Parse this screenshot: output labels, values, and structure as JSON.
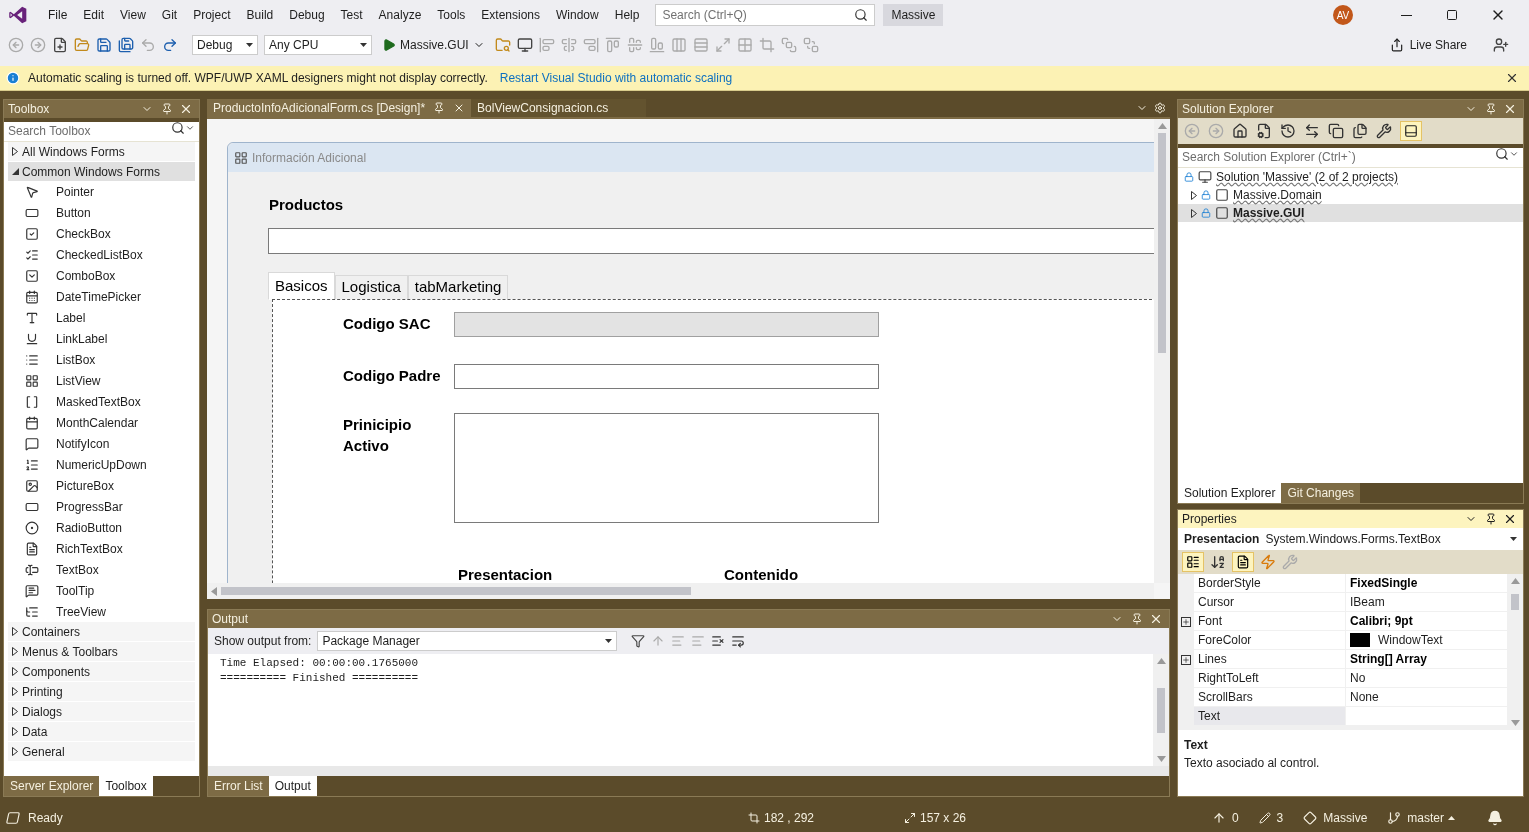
{
  "menu_bar": {
    "items": [
      "File",
      "Edit",
      "View",
      "Git",
      "Project",
      "Build",
      "Debug",
      "Test",
      "Analyze",
      "Tools",
      "Extensions",
      "Window",
      "Help"
    ],
    "search": {
      "placeholder": "Search (Ctrl+Q)"
    },
    "solution_name": "Massive",
    "avatar": "AV"
  },
  "toolbar": {
    "configuration": "Debug",
    "platform": "Any CPU",
    "start_project": "Massive.GUI",
    "live_share": "Live Share"
  },
  "info_bar": {
    "message": "Automatic scaling is turned off. WPF/UWP XAML designers might not display correctly.",
    "link": "Restart Visual Studio with automatic scaling"
  },
  "toolbox": {
    "title": "Toolbox",
    "search": {
      "placeholder": "Search Toolbox"
    },
    "groups": [
      {
        "label": "All Windows Forms",
        "expanded": false,
        "selected": false
      },
      {
        "label": "Common Windows Forms",
        "expanded": true,
        "selected": true,
        "items": [
          "Pointer",
          "Button",
          "CheckBox",
          "CheckedListBox",
          "ComboBox",
          "DateTimePicker",
          "Label",
          "LinkLabel",
          "ListBox",
          "ListView",
          "MaskedTextBox",
          "MonthCalendar",
          "NotifyIcon",
          "NumericUpDown",
          "PictureBox",
          "ProgressBar",
          "RadioButton",
          "RichTextBox",
          "TextBox",
          "ToolTip",
          "TreeView"
        ]
      },
      {
        "label": "Containers",
        "expanded": false,
        "selected": false
      },
      {
        "label": "Menus & Toolbars",
        "expanded": false,
        "selected": false
      },
      {
        "label": "Components",
        "expanded": false,
        "selected": false
      },
      {
        "label": "Printing",
        "expanded": false,
        "selected": false
      },
      {
        "label": "Dialogs",
        "expanded": false,
        "selected": false
      },
      {
        "label": "Data",
        "expanded": false,
        "selected": false
      },
      {
        "label": "General",
        "expanded": false,
        "selected": false
      }
    ],
    "tabs": [
      {
        "label": "Server Explorer",
        "selected": false
      },
      {
        "label": "Toolbox",
        "selected": true
      }
    ]
  },
  "editor": {
    "tabs": [
      {
        "label": "ProductoInfoAdicionalForm.cs [Design]*",
        "selected": true
      },
      {
        "label": "BolViewConsignacion.cs",
        "selected": false
      }
    ],
    "form": {
      "title": "Información Adicional",
      "products_label": "Productos",
      "tabs": [
        {
          "label": "Basicos",
          "selected": true
        },
        {
          "label": "Logistica",
          "selected": false
        },
        {
          "label": "tabMarketing",
          "selected": false
        }
      ],
      "fields": [
        {
          "label": "Codigo SAC",
          "kind": "textbox",
          "disabled": true
        },
        {
          "label": "Codigo Padre",
          "kind": "textbox",
          "disabled": false
        },
        {
          "label": "Prinicipio Activo",
          "kind": "multiline",
          "disabled": false
        }
      ],
      "bottom_labels": [
        "Presentacion",
        "Contenido"
      ]
    }
  },
  "output": {
    "title": "Output",
    "source_label": "Show output from:",
    "source": "Package Manager",
    "lines": [
      "Time Elapsed: 00:00:00.1765000",
      "========== Finished =========="
    ],
    "tabs": [
      {
        "label": "Error List",
        "selected": false
      },
      {
        "label": "Output",
        "selected": true
      }
    ]
  },
  "solution_explorer": {
    "title": "Solution Explorer",
    "search": {
      "placeholder": "Search Solution Explorer (Ctrl+`)"
    },
    "tree": [
      {
        "label": "Solution 'Massive' (2 of 2 projects)",
        "kind": "solution",
        "selected": false,
        "startup": false,
        "children": [
          {
            "label": "Massive.Domain",
            "kind": "project",
            "selected": false,
            "startup": false
          },
          {
            "label": "Massive.GUI",
            "kind": "project",
            "selected": true,
            "startup": true
          }
        ]
      }
    ],
    "tabs": [
      {
        "label": "Solution Explorer",
        "selected": true
      },
      {
        "label": "Git Changes",
        "selected": false
      }
    ]
  },
  "properties": {
    "title": "Properties",
    "object_name": "Presentacion",
    "object_type": "System.Windows.Forms.TextBox",
    "rows": [
      {
        "name": "BorderStyle",
        "value": "FixedSingle",
        "modified": true,
        "expandable": false,
        "selected": false
      },
      {
        "name": "Cursor",
        "value": "IBeam",
        "modified": false,
        "expandable": false,
        "selected": false
      },
      {
        "name": "Font",
        "value": "Calibri; 9pt",
        "modified": true,
        "expandable": true,
        "selected": false
      },
      {
        "name": "ForeColor",
        "value": "WindowText",
        "modified": false,
        "expandable": false,
        "selected": false,
        "color": "#000000"
      },
      {
        "name": "Lines",
        "value": "String[] Array",
        "modified": true,
        "expandable": true,
        "selected": false
      },
      {
        "name": "RightToLeft",
        "value": "No",
        "modified": false,
        "expandable": false,
        "selected": false
      },
      {
        "name": "ScrollBars",
        "value": "None",
        "modified": false,
        "expandable": false,
        "selected": false
      },
      {
        "name": "Text",
        "expandable": false,
        "selected": true
      }
    ],
    "description": {
      "title": "Text",
      "text": "Texto asociado al control."
    }
  },
  "status_bar": {
    "message": "Ready",
    "position": "182 , 292",
    "size": "157 x 26",
    "pending_pushes": "0",
    "pending_changes": "3",
    "repository": "Massive",
    "branch": "master"
  }
}
